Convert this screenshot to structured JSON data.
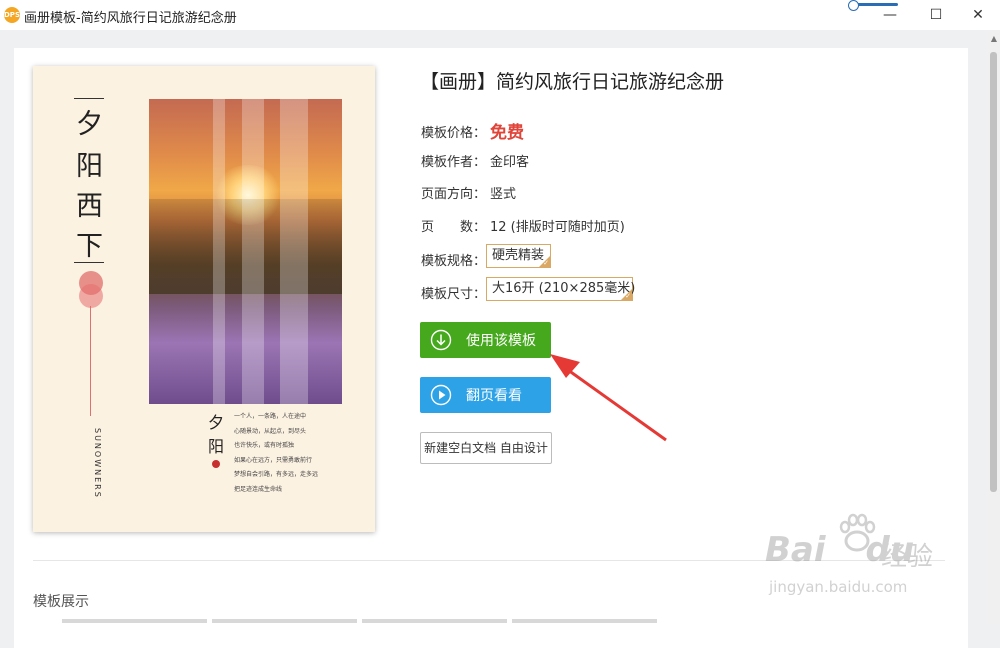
{
  "window": {
    "title": "画册模板-简约风旅行日记旅游纪念册",
    "app_icon_text": "DPS",
    "controls": {
      "minimize": "—",
      "maximize": "☐",
      "close": "✕"
    }
  },
  "cover": {
    "title_chars": [
      "夕",
      "阳",
      "西",
      "下"
    ],
    "vertical_english": "SUNOWNERS",
    "subtitle_chars": [
      "夕",
      "阳"
    ],
    "poem_lines": [
      "一个人，一条路，人在途中",
      "心随景动，从起点，到尽头",
      "也许快乐，或有时孤独",
      "如果心在远方，只需勇敢前行",
      "梦想自会引路，有多远，走多远",
      "把足迹连成生命线"
    ]
  },
  "product": {
    "title": "【画册】简约风旅行日记旅游纪念册",
    "fields": [
      {
        "label": "模板价格：",
        "value": "免费"
      },
      {
        "label": "模板作者：",
        "value": "金印客"
      },
      {
        "label": "页面方向：",
        "value": "竖式"
      },
      {
        "label": "页　　数：",
        "value": "12 (排版时可随时加页)"
      },
      {
        "label": "模板规格：",
        "value": "硬壳精装"
      },
      {
        "label": "模板尺寸：",
        "value": "大16开 (210×285毫米)"
      }
    ],
    "price_color": "#e0453a"
  },
  "buttons": {
    "use_template": "使用该模板",
    "flip_preview": "翻页看看",
    "new_blank": "新建空白文档 自由设计"
  },
  "section": {
    "template_showcase": "模板展示"
  },
  "watermark": {
    "main": "Bai",
    "main2": "du",
    "zh": "经验",
    "sub": "jingyan.baidu.com"
  },
  "colors": {
    "green_button": "#45a81d",
    "blue_button": "#2da2e6",
    "spec_border": "#d9a865",
    "arrow": "#e53935"
  }
}
